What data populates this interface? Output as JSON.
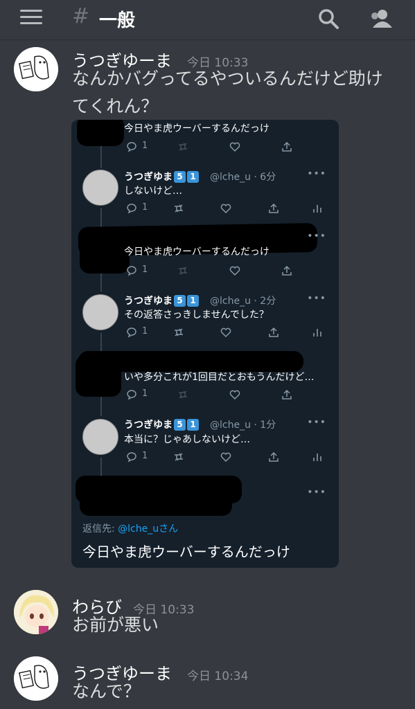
{
  "header": {
    "hash": "#",
    "channel": "一般",
    "menu_icon": "hamburger-menu-icon",
    "search_icon": "search-icon",
    "members_icon": "members-icon"
  },
  "messages": [
    {
      "author": "うつぎゆーま",
      "time": "今日 10:33",
      "lines": [
        "なんかバグってるやついるんだけど助け",
        "てくれん？"
      ]
    },
    {
      "author": "わらび",
      "time": "今日 10:33",
      "lines": [
        "お前が悪い"
      ]
    },
    {
      "author": "うつぎゆーま",
      "time": "今日 10:34",
      "lines": [
        "なんで？"
      ]
    }
  ],
  "embed": {
    "tweets": [
      {
        "text": "今日やま虎ウーバーするんだっけ",
        "reply_count": "1"
      },
      {
        "name": "うつぎゆま",
        "badges": [
          "5",
          "1"
        ],
        "handle": "@lche_u · 6分",
        "text": "しないけど…",
        "reply_count": "1"
      },
      {
        "text": "今日やま虎ウーバーするんだっけ",
        "reply_count": "1"
      },
      {
        "name": "うつぎゆま",
        "badges": [
          "5",
          "1"
        ],
        "handle": "@lche_u · 2分",
        "text": "その返答さっきしませんでした？",
        "reply_count": "1"
      },
      {
        "text": "いや多分これが1回目だとおもうんだけど…",
        "reply_count": "1"
      },
      {
        "name": "うつぎゆま",
        "badges": [
          "5",
          "1"
        ],
        "handle": "@lche_u · 1分",
        "text": "本当に？じゃあしないけど…",
        "reply_count": "1"
      }
    ],
    "more": "•••",
    "reply_to_label": "返信先:",
    "reply_to_handle": "@lche_u",
    "reply_to_suffix": "さん",
    "main_text": "今日やま虎ウーバーするんだっけ"
  },
  "colors": {
    "background": "#36393f",
    "tweet_bg": "#15202b",
    "link": "#1da1f2"
  }
}
